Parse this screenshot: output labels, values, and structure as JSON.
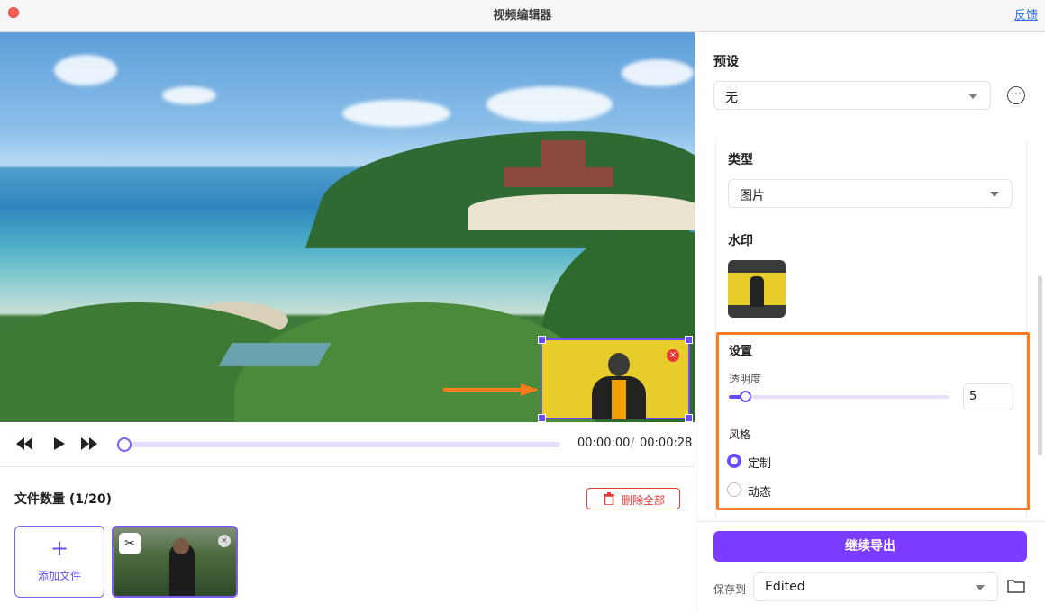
{
  "window": {
    "title": "视频编辑器",
    "feedback_link": "反馈"
  },
  "player": {
    "current_time": "00:00:00",
    "separator": "/",
    "total_time": "00:00:28",
    "progress": 0
  },
  "files": {
    "title": "文件数量 (1/20)",
    "delete_all": "删除全部",
    "add_file_plus": "+",
    "add_file": "添加文件",
    "cut_icon": "✂",
    "remove_icon": "×"
  },
  "watermark_overlay": {
    "delete_icon": "×"
  },
  "panel": {
    "preset_label": "预设",
    "preset_value": "无",
    "more_icon": "⋯",
    "type_label": "类型",
    "type_value": "图片",
    "watermark_label": "水印",
    "settings_label": "设置",
    "opacity_label": "透明度",
    "opacity_value": "5",
    "opacity_fraction": 0.05,
    "style_label": "风格",
    "style_options": [
      {
        "label": "定制",
        "selected": true
      },
      {
        "label": "动态",
        "selected": false
      }
    ],
    "export_button": "继续导出",
    "save_to_label": "保存到",
    "save_to_value": "Edited"
  },
  "colors": {
    "accent": "#7c3cff",
    "highlight": "#ff7a1a",
    "danger": "#e53935"
  }
}
